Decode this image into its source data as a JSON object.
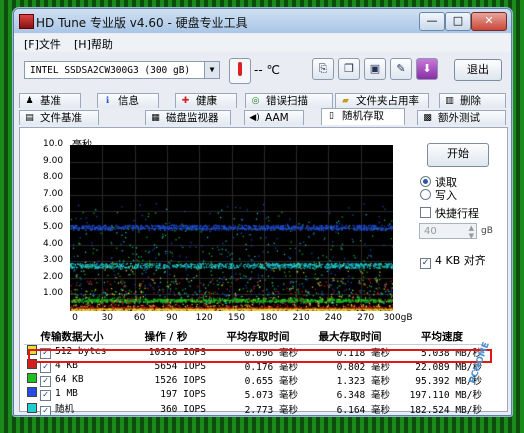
{
  "window": {
    "title": "HD Tune 专业版 v4.60 - 硬盘专业工具",
    "btn_min": "—",
    "btn_max": "□",
    "btn_close": "✕"
  },
  "menu": {
    "file": "[F]文件",
    "help": "[H]帮助"
  },
  "toolbar": {
    "drive": "INTEL SSDSA2CW300G3    (300 gB)",
    "temperature": "-- ℃",
    "exit_label": "退出",
    "icons": [
      "copy-icon",
      "copy-info-icon",
      "save-icon",
      "settings-icon",
      "download-icon"
    ]
  },
  "tabs_row1": [
    {
      "label": "基准",
      "icon": "benchmark-icon"
    },
    {
      "label": "信息",
      "icon": "info-icon"
    },
    {
      "label": "健康",
      "icon": "health-icon"
    },
    {
      "label": "错误扫描",
      "icon": "error-scan-icon"
    },
    {
      "label": "文件夹占用率",
      "icon": "folder-usage-icon"
    },
    {
      "label": "删除",
      "icon": "erase-icon"
    }
  ],
  "tabs_row2": [
    {
      "label": "文件基准",
      "icon": "file-benchmark-icon"
    },
    {
      "label": "磁盘监视器",
      "icon": "disk-monitor-icon"
    },
    {
      "label": "AAM",
      "icon": "aam-icon"
    },
    {
      "label": "随机存取",
      "icon": "random-access-icon",
      "active": true
    },
    {
      "label": "额外测试",
      "icon": "extra-tests-icon"
    }
  ],
  "chart_data": {
    "type": "scatter",
    "ylabel": "毫秒",
    "y_ticks": [
      "10.0",
      "9.00",
      "8.00",
      "7.00",
      "6.00",
      "5.00",
      "4.00",
      "3.00",
      "2.00",
      "1.00"
    ],
    "x_ticks": [
      "0",
      "30",
      "60",
      "90",
      "120",
      "150",
      "180",
      "210",
      "240",
      "270",
      "300gB"
    ],
    "xlim": [
      0,
      300
    ],
    "ylim": [
      0,
      10
    ],
    "grid": true,
    "series": [
      {
        "name": "512 bytes",
        "color": "#e8e030",
        "band_ms": [
          0.05,
          0.15
        ],
        "outlier_ms": [
          0.3,
          3.0
        ]
      },
      {
        "name": "4 KB",
        "color": "#d02020",
        "band_ms": [
          0.1,
          0.25
        ],
        "outlier_ms": [
          0.3,
          2.0
        ]
      },
      {
        "name": "64 KB",
        "color": "#20c020",
        "band_ms": [
          0.55,
          0.75
        ],
        "outlier_ms": [
          0.8,
          6.0
        ]
      },
      {
        "name": "1 MB",
        "color": "#2050e0",
        "band_ms": [
          4.9,
          5.2
        ],
        "outlier_ms": [
          1.0,
          6.5
        ]
      },
      {
        "name": "随机",
        "color": "#20d0d0",
        "band_ms": [
          2.6,
          2.9
        ],
        "outlier_ms": [
          0.5,
          6.2
        ]
      }
    ]
  },
  "controls": {
    "start": "开始",
    "read": "读取",
    "write": "写入",
    "quick": "快捷行程",
    "quick_value": "40",
    "quick_unit": "gB",
    "align": "4 KB 对齐"
  },
  "table": {
    "headers": [
      "传输数据大小",
      "操作 / 秒",
      "平均存取时间",
      "最大存取时间",
      "平均速度"
    ],
    "rows": [
      {
        "size": "512 bytes",
        "color": "#e8e030",
        "ops": "10318 IOPS",
        "avg": "0.096 毫秒",
        "max": "0.118 毫秒",
        "speed": "5.038 MB/秒"
      },
      {
        "size": "4 KB",
        "color": "#d02020",
        "ops": "5654 IOPS",
        "avg": "0.176 毫秒",
        "max": "0.802 毫秒",
        "speed": "22.089 MB/秒"
      },
      {
        "size": "64 KB",
        "color": "#20c020",
        "ops": "1526 IOPS",
        "avg": "0.655 毫秒",
        "max": "1.323 毫秒",
        "speed": "95.392 MB/秒"
      },
      {
        "size": "1 MB",
        "color": "#2050e0",
        "ops": "197 IOPS",
        "avg": "5.073 毫秒",
        "max": "6.348 毫秒",
        "speed": "197.110 MB/秒"
      },
      {
        "size": "随机",
        "color": "#20d0d0",
        "ops": "360 IOPS",
        "avg": "2.773 毫秒",
        "max": "6.164 毫秒",
        "speed": "182.524 MB/秒"
      }
    ]
  },
  "watermark": "PCHOME"
}
